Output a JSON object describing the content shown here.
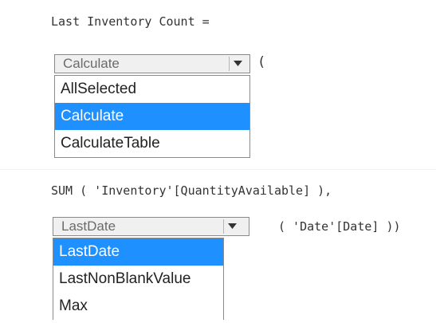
{
  "line1": "Last Inventory Count =",
  "dropdown1": {
    "selected": "Calculate",
    "suffix": "(",
    "options": [
      {
        "label": "AllSelected"
      },
      {
        "label": "Calculate",
        "selected": true
      },
      {
        "label": "CalculateTable"
      }
    ]
  },
  "line2": "SUM ( 'Inventory'[QuantityAvailable] ),",
  "dropdown2": {
    "selected": "LastDate",
    "suffix": "( 'Date'[Date] ))",
    "options": [
      {
        "label": "LastDate",
        "selected": true
      },
      {
        "label": "LastNonBlankValue"
      },
      {
        "label": "Max"
      }
    ]
  },
  "colors": {
    "selection": "#1e90ff",
    "border": "#8a8a8a",
    "combo_bg": "#f0f0f0"
  },
  "icons": {
    "dropdown_arrow": "chevron-down-icon"
  }
}
